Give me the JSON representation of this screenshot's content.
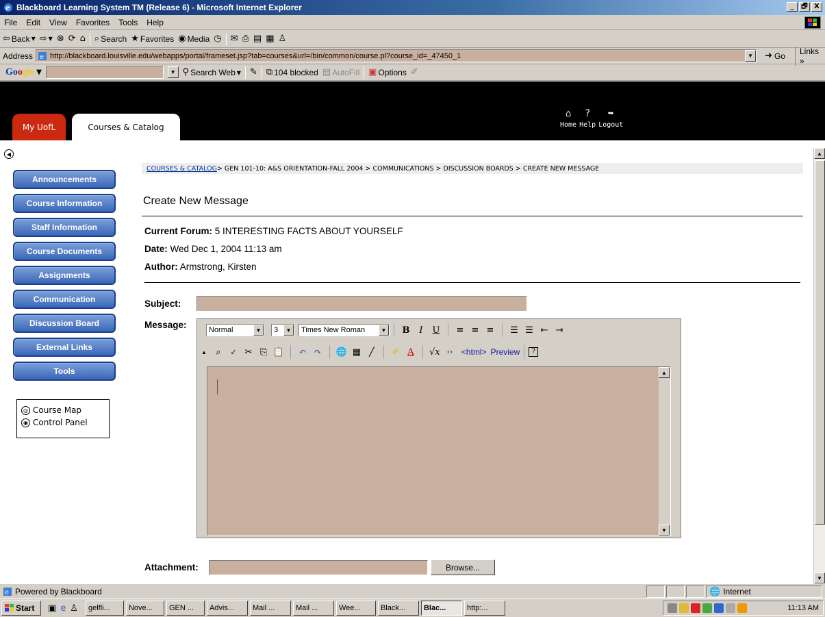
{
  "window": {
    "title": "Blackboard Learning System TM (Release 6) - Microsoft Internet Explorer",
    "controls": [
      "_",
      "🗗",
      "X"
    ]
  },
  "menu": [
    "File",
    "Edit",
    "View",
    "Favorites",
    "Tools",
    "Help"
  ],
  "toolbar": {
    "back": "Back",
    "search": "Search",
    "favorites": "Favorites",
    "media": "Media"
  },
  "address": {
    "label": "Address",
    "url": "http://blackboard.louisville.edu/webapps/portal/frameset.jsp?tab=courses&url=/bin/common/course.pl?course_id=_47450_1",
    "go": "Go",
    "links": "Links"
  },
  "google_bar": {
    "logo": "Google",
    "search_web": "Search Web",
    "blocked": "104 blocked",
    "autofill": "AutoFill",
    "options": "Options"
  },
  "header": {
    "tabs": [
      "My UofL",
      "Courses & Catalog"
    ],
    "icons": [
      {
        "icon": "home-icon",
        "label": "Home"
      },
      {
        "icon": "help-icon",
        "label": "Help"
      },
      {
        "icon": "logout-icon",
        "label": "Logout"
      }
    ]
  },
  "sidebar": {
    "buttons": [
      "Announcements",
      "Course Information",
      "Staff Information",
      "Course Documents",
      "Assignments",
      "Communication",
      "Discussion Board",
      "External Links",
      "Tools"
    ],
    "tools": [
      "Course Map",
      "Control Panel"
    ]
  },
  "breadcrumb": {
    "link": "COURSES & CATALOG",
    "rest": " > GEN 101-10: A&S ORIENTATION-FALL 2004 > COMMUNICATIONS > DISCUSSION BOARDS > CREATE NEW MESSAGE"
  },
  "form": {
    "title": "Create New Message",
    "forum_label": "Current Forum:",
    "forum_value": "5 INTERESTING FACTS ABOUT YOURSELF",
    "date_label": "Date:",
    "date_value": "Wed Dec 1, 2004 11:13 am",
    "author_label": "Author:",
    "author_value": "Armstrong, Kirsten",
    "subject_label": "Subject:",
    "subject_value": "",
    "message_label": "Message:",
    "attachment_label": "Attachment:",
    "browse": "Browse..."
  },
  "editor": {
    "style": "Normal",
    "size": "3",
    "font": "Times New Roman",
    "html_toggle": "<html>",
    "preview": "Preview"
  },
  "statusbar": {
    "text": "Powered by Blackboard",
    "zone": "Internet"
  },
  "taskbar": {
    "start": "Start",
    "tasks": [
      "gelfli...",
      "Nove...",
      "GEN ...",
      "Advis...",
      "Mail ...",
      "Mail ...",
      "Wee...",
      "Black...",
      "Blac...",
      "http:..."
    ],
    "active_index": 8,
    "clock": "11:13 AM"
  }
}
